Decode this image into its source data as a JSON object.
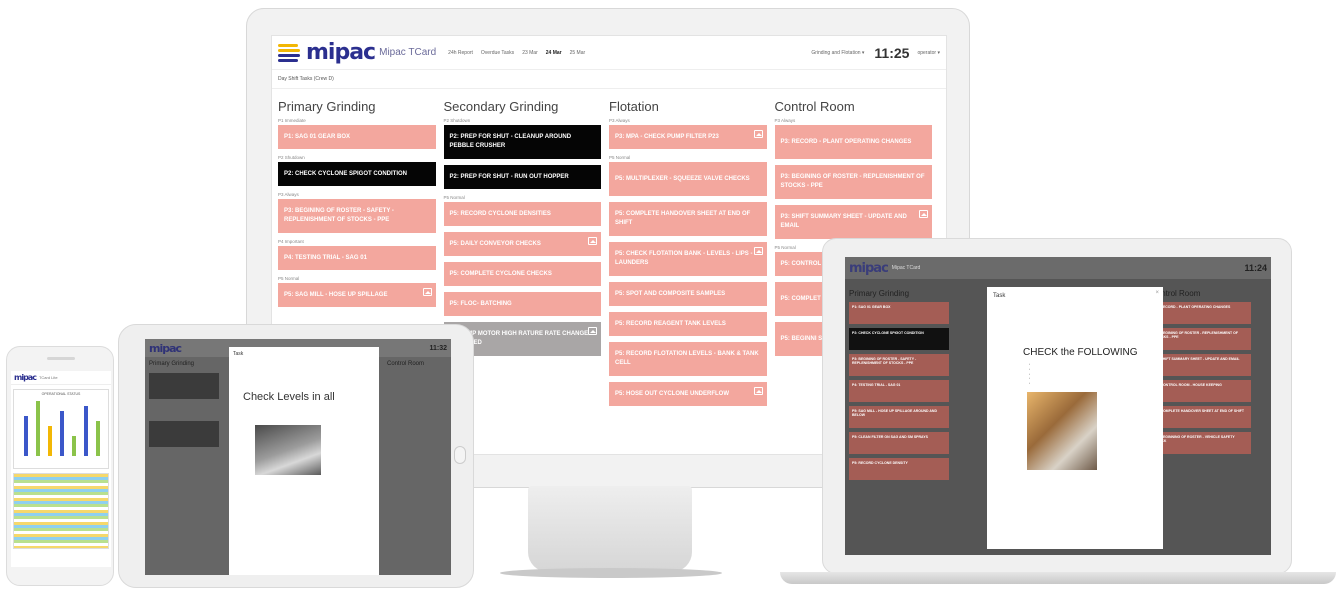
{
  "app": {
    "logo_text": "mipac",
    "product_name": "Mipac TCard",
    "nav": [
      "24h Report",
      "Overdue Tasks",
      "23 Mar",
      "24 Mar",
      "25 Mar"
    ],
    "area_select": "Grinding and Flotation ▾",
    "clock": "11:25",
    "user": "operator ▾",
    "subheader": "Day Shift Tasks (Crew D)"
  },
  "columns": [
    {
      "title": "Primary Grinding",
      "groups": [
        {
          "label": "P1 Immediate",
          "cards": [
            {
              "text": "P1: SAG 01 GEAR BOX",
              "color": "pink",
              "size": "h1",
              "image": false
            }
          ]
        },
        {
          "label": "P2 Shutdown",
          "cards": [
            {
              "text": "P2: CHECK CYCLONE SPIGOT CONDITION",
              "color": "black",
              "size": "h1",
              "image": false
            }
          ]
        },
        {
          "label": "P3 Always",
          "cards": [
            {
              "text": "P3: BEGINING OF ROSTER - SAFETY - REPLENISHMENT OF STOCKS - PPE",
              "color": "pink",
              "size": "h2",
              "image": false
            }
          ]
        },
        {
          "label": "P4 Important",
          "cards": [
            {
              "text": "P4: TESTING TRIAL - SAG 01",
              "color": "pink",
              "size": "h1",
              "image": false
            }
          ]
        },
        {
          "label": "P5 Normal",
          "cards": [
            {
              "text": "P5: SAG MILL - HOSE UP SPILLAGE",
              "color": "pink",
              "size": "h1",
              "image": true
            }
          ]
        }
      ]
    },
    {
      "title": "Secondary Grinding",
      "groups": [
        {
          "label": "P2 Shutdown",
          "cards": [
            {
              "text": "P2: PREP FOR SHUT - CLEANUP AROUND PEBBLE CRUSHER",
              "color": "black",
              "size": "h2",
              "image": false
            },
            {
              "text": "P2: PREP FOR SHUT - RUN OUT HOPPER",
              "color": "black",
              "size": "h1",
              "image": false
            }
          ]
        },
        {
          "label": "P5 Normal",
          "cards": [
            {
              "text": "P5: RECORD CYCLONE DENSITIES",
              "color": "pink",
              "size": "h1",
              "image": false
            },
            {
              "text": "P5: DAILY CONVEYOR CHECKS",
              "color": "pink",
              "size": "h1",
              "image": true
            },
            {
              "text": "P5: COMPLETE CYCLONE CHECKS",
              "color": "pink",
              "size": "h1",
              "image": false
            },
            {
              "text": "P5: FLOC- BATCHING",
              "color": "pink",
              "size": "h1",
              "image": false
            },
            {
              "text": "A - PUMP MOTOR HIGH RATURE RATE CHANGE DETECTED",
              "color": "gray",
              "size": "h2",
              "image": true
            }
          ]
        }
      ]
    },
    {
      "title": "Flotation",
      "groups": [
        {
          "label": "P3 Always",
          "cards": [
            {
              "text": "P3: MPA - CHECK PUMP FILTER P23",
              "color": "pink",
              "size": "h1",
              "image": true
            }
          ]
        },
        {
          "label": "P5 Normal",
          "cards": [
            {
              "text": "P5: MULTIPLEXER - SQUEEZE VALVE CHECKS",
              "color": "pink",
              "size": "h2",
              "image": false
            },
            {
              "text": "P5: COMPLETE HANDOVER SHEET AT END OF SHIFT",
              "color": "pink",
              "size": "h2",
              "image": false
            },
            {
              "text": "P5: CHECK FLOTATION BANK - LEVELS - LIPS - LAUNDERS",
              "color": "pink",
              "size": "h2",
              "image": true
            },
            {
              "text": "P5: SPOT AND COMPOSITE SAMPLES",
              "color": "pink",
              "size": "h1",
              "image": false
            },
            {
              "text": "P5: RECORD REAGENT TANK LEVELS",
              "color": "pink",
              "size": "h1",
              "image": false
            },
            {
              "text": "P5: RECORD FLOTATION LEVELS - BANK & TANK CELL",
              "color": "pink",
              "size": "h2",
              "image": false
            },
            {
              "text": "P5: HOSE OUT CYCLONE UNDERFLOW",
              "color": "pink",
              "size": "h1",
              "image": true
            }
          ]
        }
      ]
    },
    {
      "title": "Control Room",
      "groups": [
        {
          "label": "P3 Always",
          "cards": [
            {
              "text": "P3: RECORD - PLANT OPERATING CHANGES",
              "color": "pink",
              "size": "h2",
              "image": false
            },
            {
              "text": "P3: BEGINING OF ROSTER - REPLENISHMENT OF STOCKS - PPE",
              "color": "pink",
              "size": "h2",
              "image": false
            },
            {
              "text": "P3: SHIFT SUMMARY SHEET - UPDATE AND EMAIL",
              "color": "pink",
              "size": "h2",
              "image": true
            }
          ]
        },
        {
          "label": "P5 Normal",
          "cards": [
            {
              "text": "P5: CONTROL",
              "color": "pink",
              "size": "h1",
              "image": false
            },
            {
              "text": "P5: COMPLET END OF SHIF",
              "color": "pink",
              "size": "h2",
              "image": false
            },
            {
              "text": "P5: BEGINNI SAFETY CHE",
              "color": "pink",
              "size": "h2",
              "image": false
            }
          ]
        }
      ]
    }
  ],
  "laptop": {
    "clock": "11:24",
    "columns": [
      {
        "title": "Primary Grinding",
        "cards": [
          {
            "text": "P1: SAG 01 GEAR BOX",
            "c": "r"
          },
          {
            "text": "P2: CHECK CYCLONE SPIGOT CONDITION",
            "c": "k"
          },
          {
            "text": "P3: BEGINING OF ROSTER - SAFETY - REPLENISHMENT OF STOCKS - PPE",
            "c": "r"
          },
          {
            "text": "P4: TESTING TRIAL - SAG 01",
            "c": "r"
          },
          {
            "text": "P5: SAG MILL - HOSE UP SPILLAGE AROUND AND BELOW",
            "c": "r"
          },
          {
            "text": "P5: CLEAN FILTER ON SAG AND SM SPRAYS",
            "c": "r"
          },
          {
            "text": "P5: RECORD CYCLONE DENSITY",
            "c": "r"
          }
        ]
      },
      {
        "title": "Control Room",
        "cards": [
          {
            "text": "P3: RECORD - PLANT OPERATING CHANGES",
            "c": "r"
          },
          {
            "text": "P3: BEGINING OF ROSTER - REPLENISHMENT OF STOCKS - PPE",
            "c": "r"
          },
          {
            "text": "P3: SHIFT SUMMARY SHEET - UPDATE AND EMAIL",
            "c": "r"
          },
          {
            "text": "P5: CONTROL ROOM - HOUSE KEEPING",
            "c": "r"
          },
          {
            "text": "P5: COMPLETE HANDOVER SHEET AT END OF SHIFT",
            "c": "r"
          },
          {
            "text": "P5: BEGINNING OF ROSTER - VEHICLE SAFETY CHECK",
            "c": "r"
          }
        ]
      }
    ],
    "modal": {
      "title": "Task",
      "close": "×",
      "heading": "CHECK the FOLLOWING"
    }
  },
  "tablet": {
    "clock": "11:32",
    "col1": "Primary Grinding",
    "col2": "Control Room",
    "modal": {
      "title": "Task",
      "heading": "Check Levels in all"
    }
  },
  "phone": {
    "logo_text": "mipac",
    "product_name": "TCard Lite",
    "chart_title": "OPERATIONAL STATUS"
  },
  "colors": {
    "pink": "#f3a79e",
    "black": "#050505",
    "gray": "#a9a6a6",
    "brand": "#2b2f8f"
  }
}
